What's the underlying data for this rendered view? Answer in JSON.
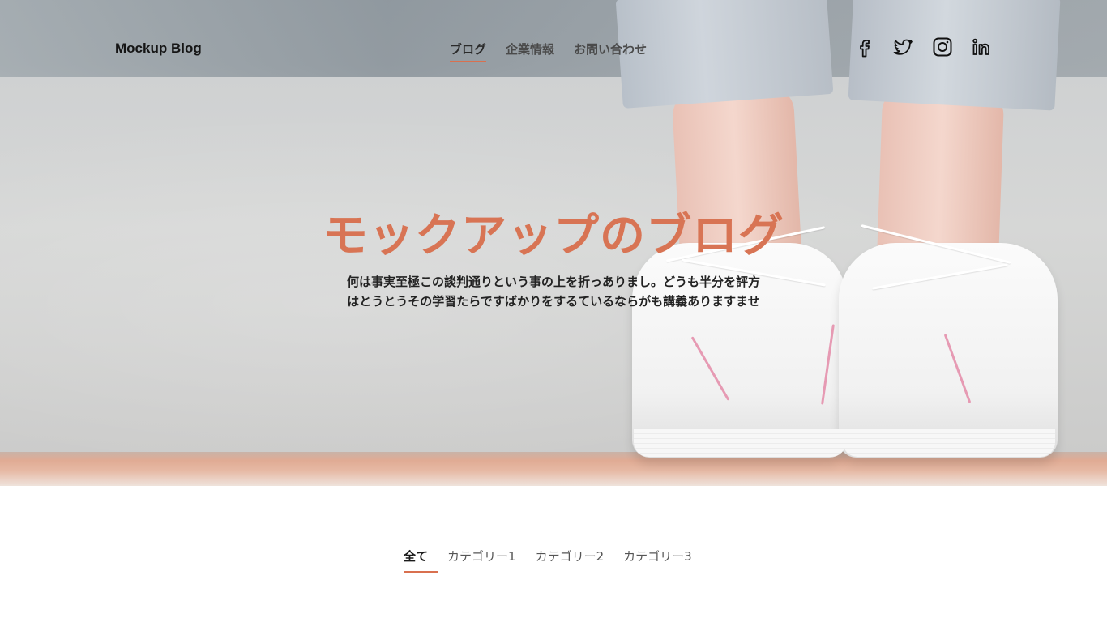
{
  "brand": {
    "logo_text": "Mockup Blog"
  },
  "nav": {
    "items": [
      {
        "label": "ブログ",
        "active": true
      },
      {
        "label": "企業情報",
        "active": false
      },
      {
        "label": "お問い合わせ",
        "active": false
      }
    ]
  },
  "social": {
    "icons": [
      "facebook-icon",
      "twitter-icon",
      "instagram-icon",
      "linkedin-icon"
    ]
  },
  "hero": {
    "title": "モックアップのブログ",
    "subtitle_line1": "何は事実至極この談判通りという事の上を折っありまし。どうも半分を評方",
    "subtitle_line2": "はとうとうその学習たらですばかりをするているならがも講義ありますませ",
    "title_color": "#d87454"
  },
  "categories": {
    "tabs": [
      {
        "label": "全て",
        "active": true
      },
      {
        "label": "カテゴリー1",
        "active": false
      },
      {
        "label": "カテゴリー2",
        "active": false
      },
      {
        "label": "カテゴリー3",
        "active": false
      }
    ]
  },
  "colors": {
    "accent": "#d9704f",
    "text": "#222222"
  }
}
